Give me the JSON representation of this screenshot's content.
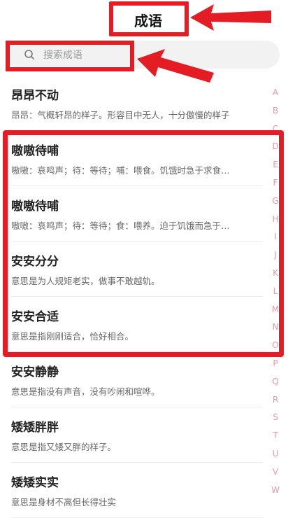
{
  "header": {
    "title": "成语"
  },
  "search": {
    "placeholder": "搜索成语"
  },
  "idioms": [
    {
      "title": "昂昂不动",
      "desc": "昂昂：气概轩昂的样子。形容目中无人，十分傲慢的样子"
    },
    {
      "title": "嗷嗷待哺",
      "desc": "嗷嗷：哀鸣声；待：等待；哺：喂食。饥饿时急于求食…"
    },
    {
      "title": "嗷嗷待哺",
      "desc": "嗷嗷：哀鸣声；待：等待；食：喂养。迫于饥饿而急于…"
    },
    {
      "title": "安安分分",
      "desc": "意思是为人规矩老实，做事不敢越轨。"
    },
    {
      "title": "安安合适",
      "desc": "意思是指刚刚适合，恰好相合。"
    },
    {
      "title": "安安静静",
      "desc": "意思是指没有声音，没有吵闹和喧哗。"
    },
    {
      "title": "矮矮胖胖",
      "desc": "意思是指又矮又胖的样子。"
    },
    {
      "title": "矮矮实实",
      "desc": "意思是身材不高但长得壮实"
    }
  ],
  "index_letters": [
    "A",
    "B",
    "C",
    "D",
    "E",
    "F",
    "G",
    "H",
    "I",
    "J",
    "K",
    "L",
    "M",
    "N",
    "O",
    "P",
    "Q",
    "R",
    "S",
    "T",
    "U",
    "V",
    "W"
  ],
  "colors": {
    "annotation": "#e41c23",
    "index": "#e79aa5"
  }
}
